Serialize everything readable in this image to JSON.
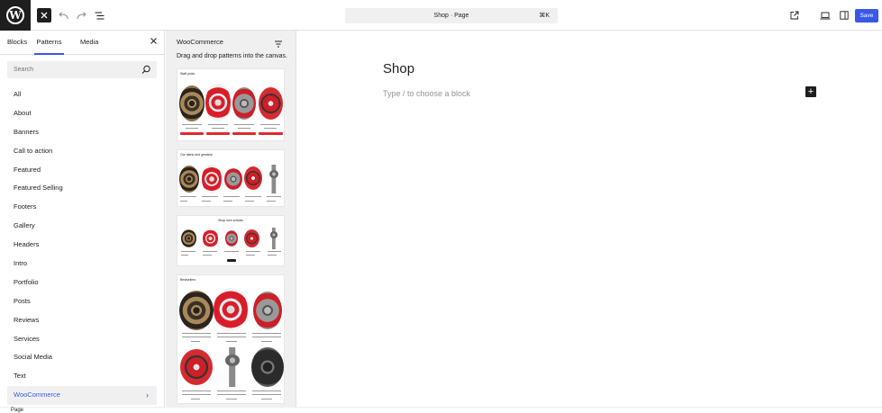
{
  "topbar": {
    "document_title": "Shop · Page",
    "shortcut": "⌘K",
    "save_label": "Save",
    "icons": [
      "wordpress-logo",
      "close-icon",
      "undo-icon",
      "redo-icon",
      "document-overview-icon",
      "view-external-icon",
      "device-preview-icon",
      "sidebar-toggle-icon"
    ]
  },
  "inserter": {
    "tabs": [
      {
        "label": "Blocks",
        "active": false
      },
      {
        "label": "Patterns",
        "active": true
      },
      {
        "label": "Media",
        "active": false
      }
    ],
    "search_placeholder": "Search",
    "categories": [
      {
        "label": "All"
      },
      {
        "label": "About"
      },
      {
        "label": "Banners"
      },
      {
        "label": "Call to action"
      },
      {
        "label": "Featured"
      },
      {
        "label": "Featured Selling"
      },
      {
        "label": "Footers"
      },
      {
        "label": "Gallery"
      },
      {
        "label": "Headers"
      },
      {
        "label": "Intro"
      },
      {
        "label": "Portfolio"
      },
      {
        "label": "Posts"
      },
      {
        "label": "Reviews"
      },
      {
        "label": "Services"
      },
      {
        "label": "Social Media"
      },
      {
        "label": "Text"
      },
      {
        "label": "WooCommerce",
        "selected": true
      }
    ],
    "bottom_text": "Page"
  },
  "patterns": {
    "category_title": "WooCommerce",
    "description": "Drag and drop patterns into the canvas.",
    "cards": [
      {
        "title": "Staff picks"
      },
      {
        "title": "Our latest and greatest"
      },
      {
        "title": "Shop new arrivals"
      },
      {
        "title": "Bestsellers"
      }
    ]
  },
  "canvas": {
    "page_title": "Shop",
    "placeholder": "Type / to choose a block",
    "add_block_label": "+"
  },
  "colors": {
    "accent": "#3858e9",
    "dark": "#1e1e1e",
    "product_red": "#e0292f"
  }
}
